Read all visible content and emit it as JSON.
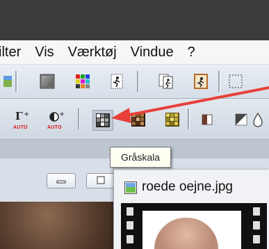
{
  "menu": {
    "items": [
      "ilter",
      "Vis",
      "Værktøj",
      "Vindue",
      "?"
    ]
  },
  "tooltip": {
    "text": "Gråskala"
  },
  "toolbar2": {
    "auto_label_1": "AUTO",
    "auto_label_2": "AUTO"
  },
  "file_window": {
    "title": "roede oejne.jpg"
  },
  "colors": {
    "arrow": "#e8413a",
    "tooltip_bg": "#fffff1",
    "titlebar": "#3c3c3c"
  }
}
